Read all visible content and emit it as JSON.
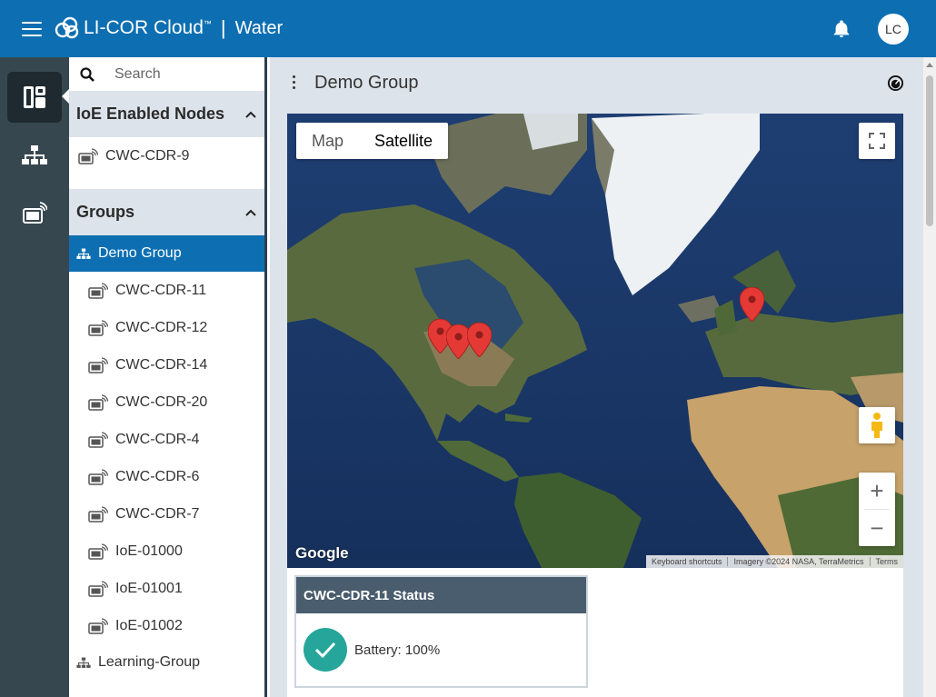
{
  "header": {
    "brand": "LI-COR Cloud",
    "trademark": "™",
    "separator": "|",
    "app_name": "Water",
    "avatar_initials": "LC",
    "bar_color": "#0d6fb2"
  },
  "rail": {
    "items": [
      {
        "icon": "dashboard-icon",
        "active": true
      },
      {
        "icon": "sitemap-icon",
        "active": false
      },
      {
        "icon": "device-signal-icon",
        "active": false
      }
    ]
  },
  "search": {
    "placeholder": "Search",
    "value": ""
  },
  "nodes_section": {
    "title": "IoE Enabled Nodes",
    "items": [
      "CWC-CDR-9"
    ]
  },
  "groups_section": {
    "title": "Groups",
    "groups": [
      {
        "name": "Demo Group",
        "active": true,
        "nodes": [
          "CWC-CDR-11",
          "CWC-CDR-12",
          "CWC-CDR-14",
          "CWC-CDR-20",
          "CWC-CDR-4",
          "CWC-CDR-6",
          "CWC-CDR-7",
          "IoE-01000",
          "IoE-01001",
          "IoE-01002"
        ]
      },
      {
        "name": "Learning-Group",
        "active": false,
        "nodes": []
      }
    ]
  },
  "main": {
    "title": "Demo Group"
  },
  "map": {
    "type_options": [
      "Map",
      "Satellite"
    ],
    "selected_type": "Satellite",
    "google_label": "Google",
    "attribution": [
      "Keyboard shortcuts",
      "Imagery ©2024 NASA, TerraMetrics",
      "Terms"
    ],
    "zoom_in": "+",
    "zoom_out": "−",
    "marker_color": "#e53935"
  },
  "status_card": {
    "title": "CWC-CDR-11 Status",
    "battery_text": "Battery: 100%",
    "check_color": "#26a69a"
  }
}
